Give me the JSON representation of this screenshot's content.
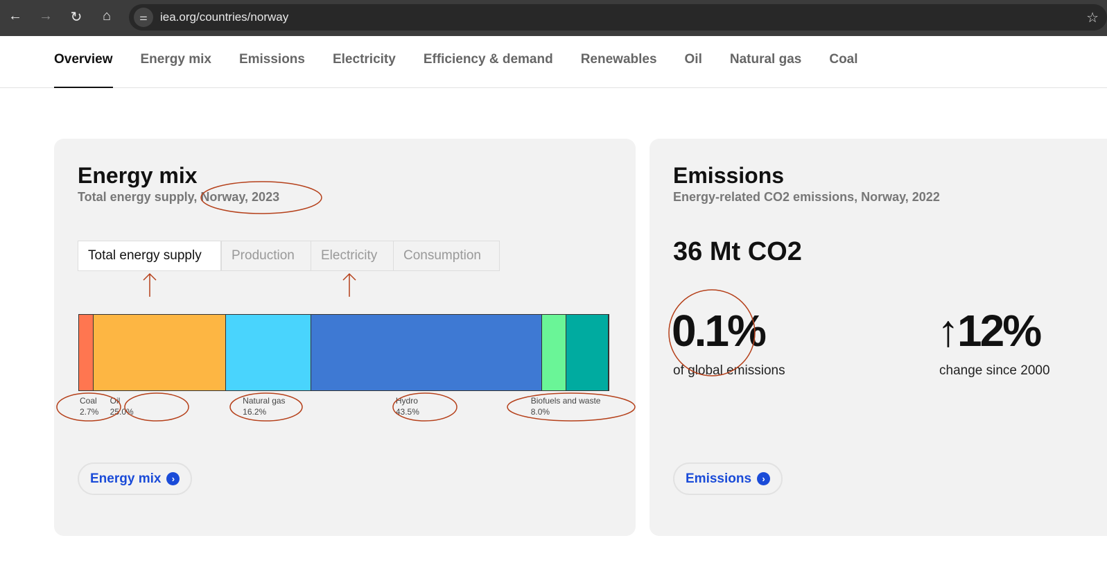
{
  "browser": {
    "url": "iea.org/countries/norway"
  },
  "nav": {
    "tabs": [
      "Overview",
      "Energy mix",
      "Emissions",
      "Electricity",
      "Efficiency & demand",
      "Renewables",
      "Oil",
      "Natural gas",
      "Coal"
    ],
    "active": "Overview"
  },
  "energy_mix": {
    "title": "Energy mix",
    "subtitle": "Total energy supply, Norway, 2023",
    "toggles": [
      "Total energy supply",
      "Production",
      "Electricity",
      "Consumption"
    ],
    "active_toggle": "Total energy supply",
    "link": "Energy mix"
  },
  "chart_data": {
    "type": "bar",
    "stacked": true,
    "orientation": "horizontal",
    "segments": [
      {
        "name": "Coal",
        "label": "2.7%",
        "value": 2.7,
        "color": "#ff7650"
      },
      {
        "name": "Oil",
        "label": "25.0%",
        "value": 25.0,
        "color": "#fdb643"
      },
      {
        "name": "Natural gas",
        "label": "16.2%",
        "value": 16.2,
        "color": "#49d4fd"
      },
      {
        "name": "Hydro",
        "label": "43.5%",
        "value": 43.5,
        "color": "#3e79d3"
      },
      {
        "name": "",
        "label": "",
        "value": 4.6,
        "color": "#6af597"
      },
      {
        "name": "Biofuels and waste",
        "label": "8.0%",
        "value": 8.0,
        "color": "#00aba0"
      }
    ]
  },
  "emissions": {
    "title": "Emissions",
    "subtitle": "Energy-related CO2 emissions, Norway, 2022",
    "total": "36 Mt CO2",
    "share": "0.1%",
    "share_caption": "of global emissions",
    "change": "↑12%",
    "change_caption": "change since 2000",
    "link": "Emissions"
  },
  "colors": {
    "link": "#1a4bd8",
    "annotation": "#b5401a"
  }
}
